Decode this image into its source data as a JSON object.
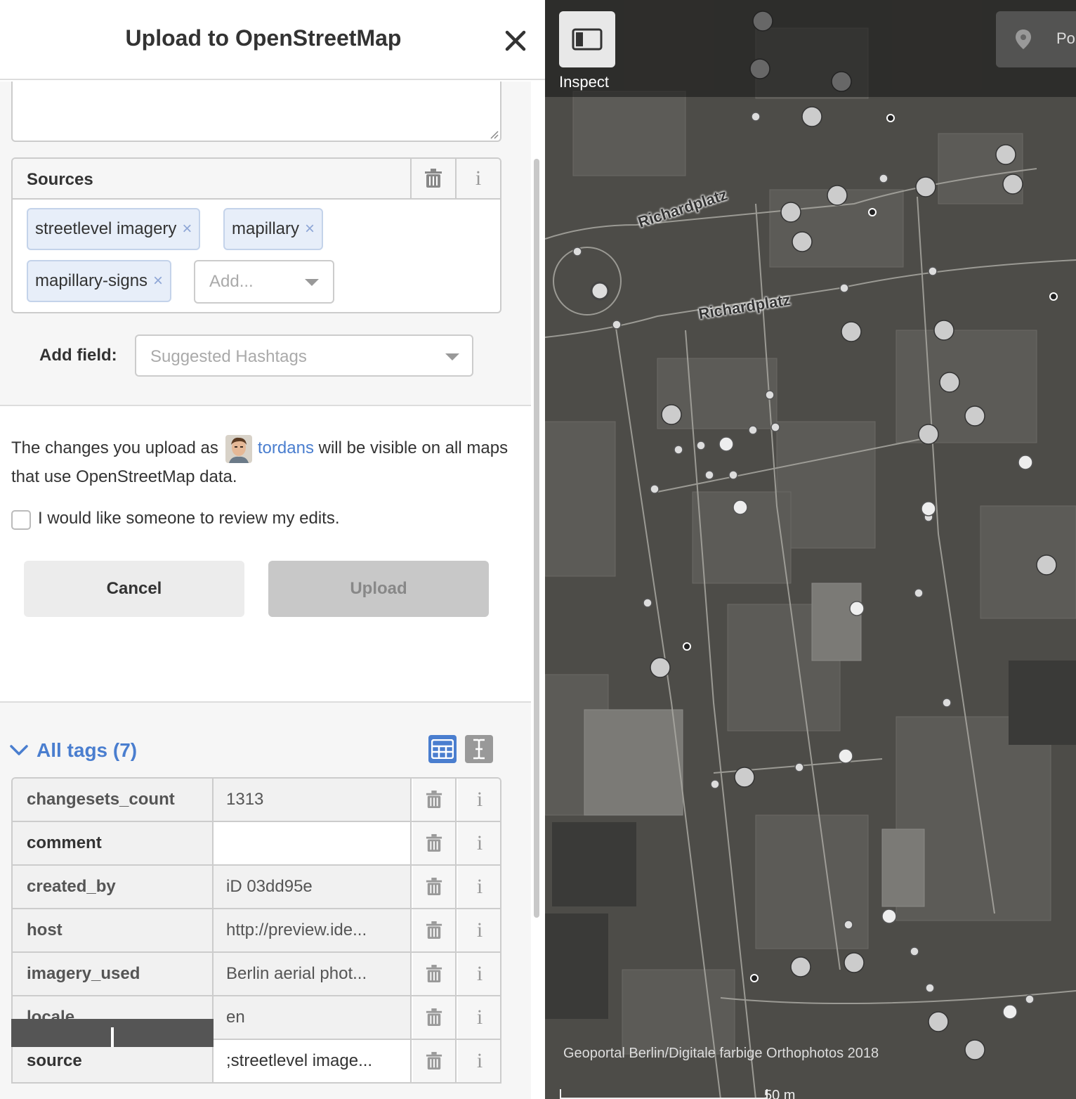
{
  "header": {
    "title": "Upload to OpenStreetMap"
  },
  "sources": {
    "label": "Sources",
    "chips": [
      "streetlevel imagery",
      "mapillary",
      "mapillary-signs"
    ],
    "chip_remove": "×",
    "add_placeholder": "Add..."
  },
  "add_field": {
    "label": "Add field:",
    "placeholder": "Suggested Hashtags"
  },
  "upload_info": {
    "text_before": "The changes you upload as",
    "username": "tordans",
    "text_after": "will be visible on all maps that use OpenStreetMap data."
  },
  "review": {
    "label": "I would like someone to review my edits.",
    "checked": false
  },
  "buttons": {
    "cancel": "Cancel",
    "upload": "Upload"
  },
  "tags": {
    "toggle_label": "All tags (7)",
    "rows": [
      {
        "key": "changesets_count",
        "value": "1313",
        "editable": false
      },
      {
        "key": "comment",
        "value": "",
        "editable": true
      },
      {
        "key": "created_by",
        "value": "iD 03dd95e",
        "editable": false
      },
      {
        "key": "host",
        "value": "http://preview.ide...",
        "editable": false
      },
      {
        "key": "imagery_used",
        "value": "Berlin aerial phot...",
        "editable": false
      },
      {
        "key": "locale",
        "value": "en",
        "editable": false
      },
      {
        "key": "source",
        "value": ";streetlevel image...",
        "editable": true
      }
    ],
    "info_glyph": "i"
  },
  "map": {
    "inspect_label": "Inspect",
    "point_label": "Poi",
    "street_labels": [
      "Richardplatz",
      "Richardplatz"
    ],
    "attribution": "Geoportal Berlin/Digitale farbige Orthophotos 2018",
    "scale_label": "50 m"
  },
  "colors": {
    "accent": "#4a7ecf",
    "chip_bg": "#e7eef9",
    "upload_disabled": "#c8c8c8"
  }
}
